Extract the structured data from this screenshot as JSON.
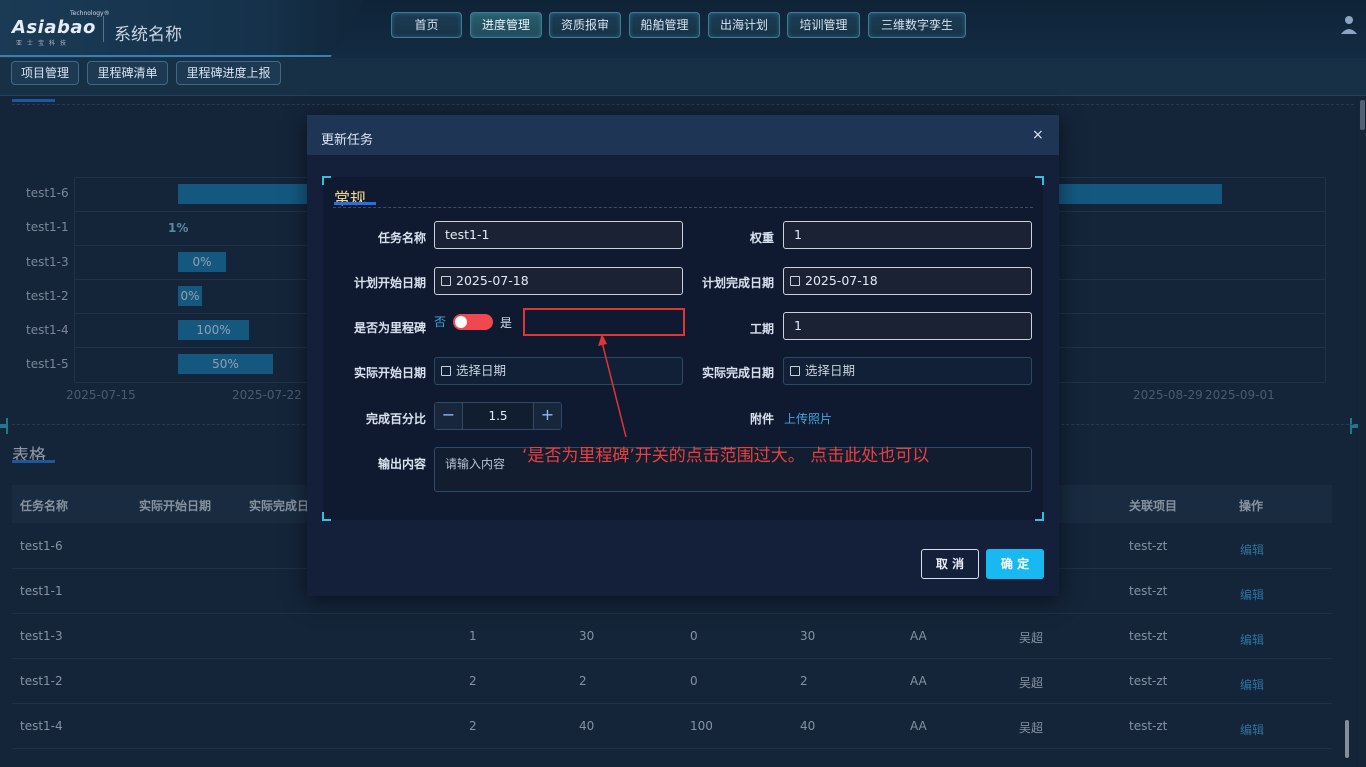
{
  "header": {
    "logo_tech": "Technology®",
    "logo_text": "Asiabao",
    "logo_cn": "亚士宝科技",
    "system_name": "系统名称",
    "nav": [
      {
        "label": "首页",
        "active": false
      },
      {
        "label": "进度管理",
        "active": true
      },
      {
        "label": "资质报审",
        "active": false
      },
      {
        "label": "船舶管理",
        "active": false
      },
      {
        "label": "出海计划",
        "active": false
      },
      {
        "label": "培训管理",
        "active": false
      },
      {
        "label": "三维数字孪生",
        "active": false
      }
    ]
  },
  "subnav": [
    "项目管理",
    "里程碑清单",
    "里程碑进度上报"
  ],
  "gantt": {
    "rows": [
      {
        "name": "test1-6",
        "label": ""
      },
      {
        "name": "test1-1",
        "label": "1%"
      },
      {
        "name": "test1-3",
        "label": "0%"
      },
      {
        "name": "test1-2",
        "label": "0%"
      },
      {
        "name": "test1-4",
        "label": "100%"
      },
      {
        "name": "test1-5",
        "label": "50%"
      }
    ],
    "axis": [
      "2025-07-15",
      "2025-07-22",
      "2025-08-29",
      "2025-09-01"
    ]
  },
  "table": {
    "section_title": "表格",
    "columns": [
      "任务名称",
      "实际开始日期",
      "实际完成日",
      "关联项目",
      "操作"
    ],
    "rows": [
      {
        "name": "test1-6",
        "c1": "",
        "c2": "",
        "c3": "",
        "c4": "",
        "c5": "",
        "c6": "",
        "project": "test-zt",
        "action": "编辑"
      },
      {
        "name": "test1-1",
        "c1": "",
        "c2": "",
        "c3": "",
        "c4": "",
        "c5": "",
        "c6": "",
        "project": "test-zt",
        "action": "编辑"
      },
      {
        "name": "test1-3",
        "c1": "1",
        "c2": "30",
        "c3": "0",
        "c4": "30",
        "c5": "AA",
        "c6": "吴超",
        "project": "test-zt",
        "action": "编辑"
      },
      {
        "name": "test1-2",
        "c1": "2",
        "c2": "2",
        "c3": "0",
        "c4": "2",
        "c5": "AA",
        "c6": "吴超",
        "project": "test-zt",
        "action": "编辑"
      },
      {
        "name": "test1-4",
        "c1": "2",
        "c2": "40",
        "c3": "100",
        "c4": "40",
        "c5": "AA",
        "c6": "吴超",
        "project": "test-zt",
        "action": "编辑"
      }
    ]
  },
  "modal": {
    "title": "更新任务",
    "close": "×",
    "section": "常规",
    "fields": {
      "task_name_label": "任务名称",
      "task_name_value": "test1-1",
      "weight_label": "权重",
      "weight_value": "1",
      "plan_start_label": "计划开始日期",
      "plan_start_value": "2025-07-18",
      "plan_end_label": "计划完成日期",
      "plan_end_value": "2025-07-18",
      "milestone_label": "是否为里程碑",
      "milestone_off": "否",
      "milestone_on": "是",
      "milestone_checked": false,
      "duration_label": "工期",
      "duration_value": "1",
      "actual_start_label": "实际开始日期",
      "actual_start_placeholder": "选择日期",
      "actual_end_label": "实际完成日期",
      "actual_end_placeholder": "选择日期",
      "percent_label": "完成百分比",
      "percent_value": "1.5",
      "minus": "−",
      "plus": "+",
      "attachment_label": "附件",
      "attachment_link": "上传照片",
      "output_label": "输出内容",
      "output_placeholder": "请输入内容"
    },
    "cancel": "取 消",
    "ok": "确 定"
  },
  "annotation": {
    "text": "‘是否为里程碑’开关的点击范围过大。  点击此处也可以",
    "color": "#e03535"
  }
}
